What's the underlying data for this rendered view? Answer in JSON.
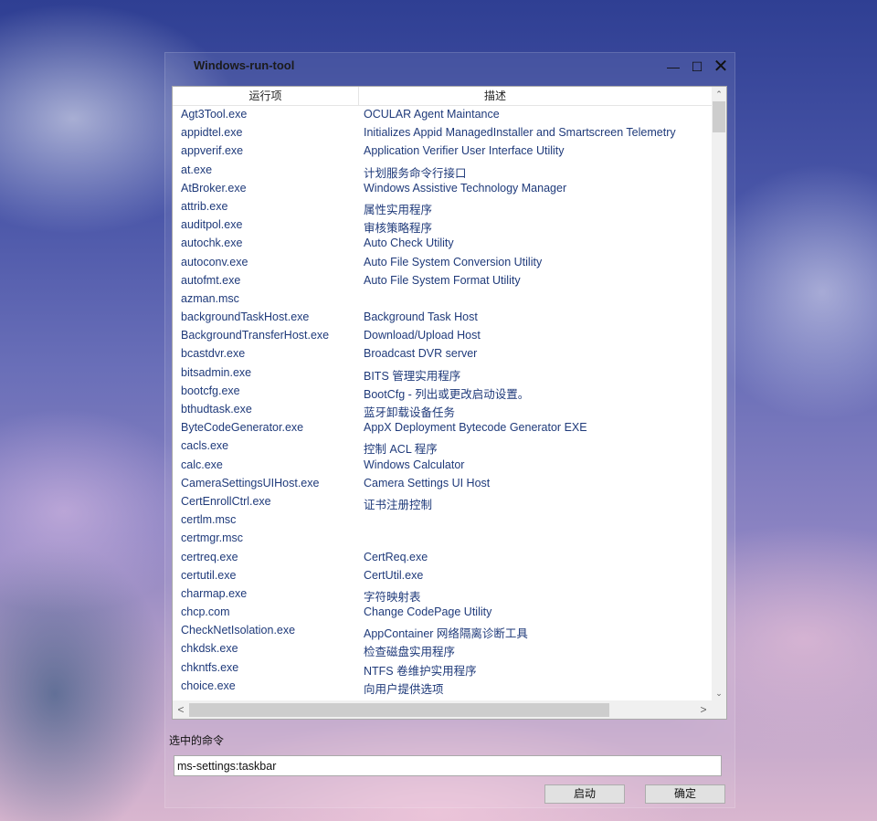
{
  "window": {
    "title": "Windows-run-tool",
    "controls": {
      "minimize": "—",
      "maximize": "☐",
      "close": "✕"
    }
  },
  "list": {
    "columns": [
      "运行项",
      "描述"
    ],
    "rows": [
      [
        "Agt3Tool.exe",
        "OCULAR Agent Maintance"
      ],
      [
        "appidtel.exe",
        "Initializes Appid ManagedInstaller and Smartscreen Telemetry"
      ],
      [
        "appverif.exe",
        "Application Verifier User Interface Utility"
      ],
      [
        "at.exe",
        "计划服务命令行接口"
      ],
      [
        "AtBroker.exe",
        "Windows Assistive Technology Manager"
      ],
      [
        "attrib.exe",
        "属性实用程序"
      ],
      [
        "auditpol.exe",
        "审核策略程序"
      ],
      [
        "autochk.exe",
        "Auto Check Utility"
      ],
      [
        "autoconv.exe",
        "Auto File System Conversion Utility"
      ],
      [
        "autofmt.exe",
        "Auto File System Format Utility"
      ],
      [
        "azman.msc",
        ""
      ],
      [
        "backgroundTaskHost.exe",
        "Background Task Host"
      ],
      [
        "BackgroundTransferHost.exe",
        "Download/Upload Host"
      ],
      [
        "bcastdvr.exe",
        "Broadcast DVR server"
      ],
      [
        "bitsadmin.exe",
        "BITS 管理实用程序"
      ],
      [
        "bootcfg.exe",
        "BootCfg - 列出或更改启动设置。"
      ],
      [
        "bthudtask.exe",
        "蓝牙卸载设备任务"
      ],
      [
        "ByteCodeGenerator.exe",
        "AppX Deployment Bytecode Generator EXE"
      ],
      [
        "cacls.exe",
        "控制 ACL 程序"
      ],
      [
        "calc.exe",
        "Windows Calculator"
      ],
      [
        "CameraSettingsUIHost.exe",
        "Camera Settings UI Host"
      ],
      [
        "CertEnrollCtrl.exe",
        "证书注册控制"
      ],
      [
        "certlm.msc",
        ""
      ],
      [
        "certmgr.msc",
        ""
      ],
      [
        "certreq.exe",
        "CertReq.exe"
      ],
      [
        "certutil.exe",
        "CertUtil.exe"
      ],
      [
        "charmap.exe",
        "字符映射表"
      ],
      [
        "chcp.com",
        "Change CodePage Utility"
      ],
      [
        "CheckNetIsolation.exe",
        "AppContainer 网络隔离诊断工具"
      ],
      [
        "chkdsk.exe",
        "检查磁盘实用程序"
      ],
      [
        "chkntfs.exe",
        "NTFS 卷维护实用程序"
      ],
      [
        "choice.exe",
        "向用户提供选项"
      ]
    ]
  },
  "scrollbar": {
    "up": "⌃",
    "down": "⌄",
    "left": "<",
    "right": ">"
  },
  "selected": {
    "label": "选中的命令",
    "value": "ms-settings:taskbar"
  },
  "buttons": {
    "start": "启动",
    "ok": "确定"
  }
}
